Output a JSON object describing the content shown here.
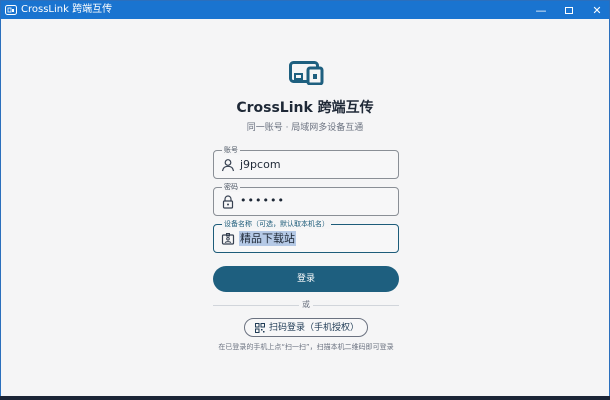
{
  "window": {
    "title": "CrossLink 跨端互传",
    "controls": {
      "minimize": "—",
      "close": "✕"
    }
  },
  "login": {
    "heading": "CrossLink 跨端互传",
    "subtitle": "同一账号 · 局域网多设备互通",
    "account": {
      "label": "账号",
      "value": "j9pcom"
    },
    "password": {
      "label": "密码",
      "value": "••••••"
    },
    "device": {
      "label": "设备名称（可选，默认取本机名）",
      "value": "精品下载站"
    },
    "login_button": "登录",
    "or_text": "或",
    "qr_button": "扫码登录（手机授权）",
    "hint": "在已登录的手机上点“扫一扫”，扫描本机二维码即可登录"
  },
  "colors": {
    "titlebar": "#1a74d0",
    "accent": "#1e5f7f",
    "background": "#f5f5f6"
  }
}
